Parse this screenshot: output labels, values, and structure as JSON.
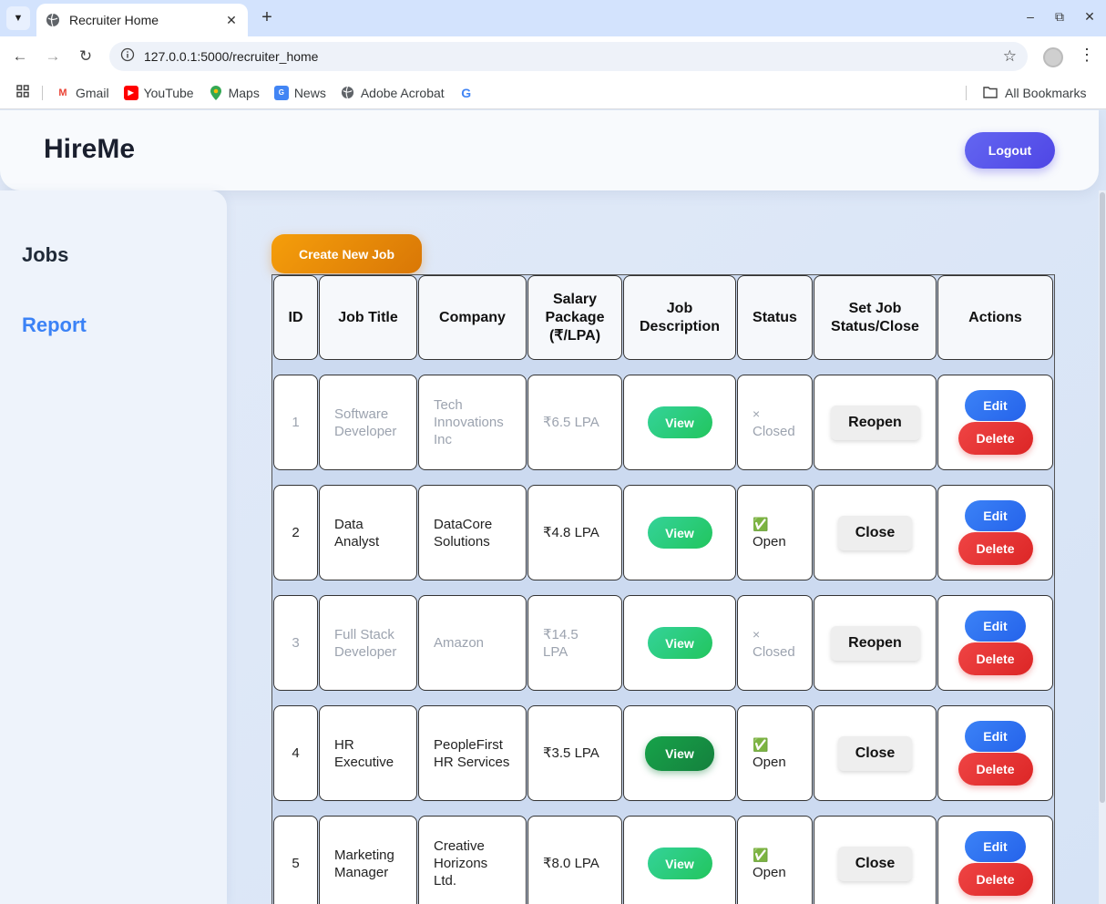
{
  "browser": {
    "tab_title": "Recruiter Home",
    "url": "127.0.0.1:5000/recruiter_home",
    "bookmarks": [
      {
        "label": "Gmail",
        "icon": "gmail-icon"
      },
      {
        "label": "YouTube",
        "icon": "youtube-icon"
      },
      {
        "label": "Maps",
        "icon": "maps-icon"
      },
      {
        "label": "News",
        "icon": "news-icon"
      },
      {
        "label": "Adobe Acrobat",
        "icon": "globe-icon"
      }
    ],
    "all_bookmarks_label": "All Bookmarks"
  },
  "header": {
    "brand": "HireMe",
    "logout_label": "Logout"
  },
  "sidebar": {
    "items": [
      {
        "label": "Jobs"
      },
      {
        "label": "Report"
      }
    ]
  },
  "main": {
    "create_button": "Create New Job",
    "table": {
      "headers": [
        "ID",
        "Job Title",
        "Company",
        "Salary Package (₹/LPA)",
        "Job Description",
        "Status",
        "Set Job Status/Close",
        "Actions"
      ],
      "view_label": "View",
      "edit_label": "Edit",
      "delete_label": "Delete",
      "rows": [
        {
          "id": "1",
          "title": "Software Developer",
          "company": "Tech Innovations Inc",
          "salary": "₹6.5 LPA",
          "status": "Closed",
          "status_icon": "×",
          "set_label": "Reopen"
        },
        {
          "id": "2",
          "title": "Data Analyst",
          "company": "DataCore Solutions",
          "salary": "₹4.8 LPA",
          "status": "Open",
          "status_icon": "✅",
          "set_label": "Close"
        },
        {
          "id": "3",
          "title": "Full Stack Developer",
          "company": "Amazon",
          "salary": "₹14.5 LPA",
          "status": "Closed",
          "status_icon": "×",
          "set_label": "Reopen"
        },
        {
          "id": "4",
          "title": "HR Executive",
          "company": "PeopleFirst HR Services",
          "salary": "₹3.5 LPA",
          "status": "Open",
          "status_icon": "✅",
          "set_label": "Close"
        },
        {
          "id": "5",
          "title": "Marketing Manager",
          "company": "Creative Horizons Ltd.",
          "salary": "₹8.0 LPA",
          "status": "Open",
          "status_icon": "✅",
          "set_label": "Close"
        }
      ]
    }
  },
  "colors": {
    "accent": "#3b82f6",
    "logout": "#4f46e5",
    "create": "#f59e0b",
    "view": "#22c55e",
    "delete": "#dc2626"
  }
}
